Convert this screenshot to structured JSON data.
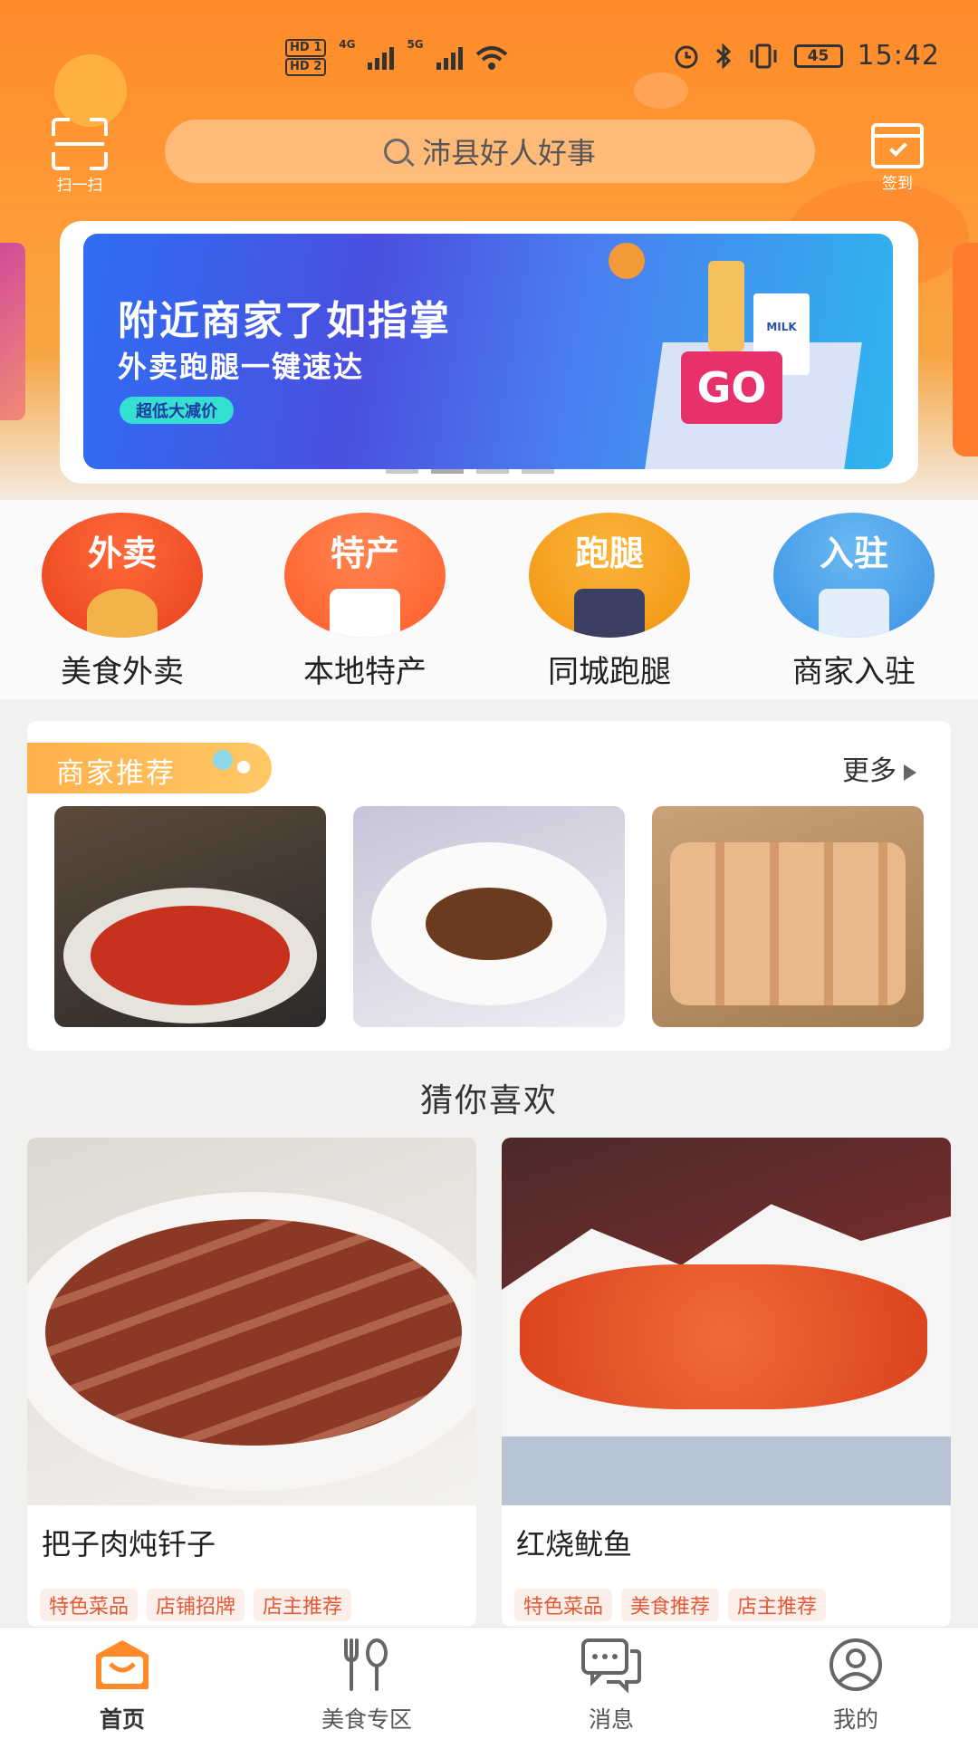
{
  "status_bar": {
    "hd1": "HD 1",
    "hd2": "HD 2",
    "net1": "4G",
    "net2": "5G",
    "battery": "45",
    "time": "15:42"
  },
  "header": {
    "scan_label": "扫一扫",
    "search_placeholder": "沛县好人好事",
    "checkin_label": "签到"
  },
  "banner": {
    "headline": "附近商家了如指掌",
    "subline": "外卖跑腿一键速达",
    "pill": "超低大减价",
    "go": "GO",
    "milk": "MILK"
  },
  "categories": [
    {
      "badge": "外卖",
      "name": "美食外卖",
      "color": "#f0512a"
    },
    {
      "badge": "特产",
      "name": "本地特产",
      "color": "#ff6c36"
    },
    {
      "badge": "跑腿",
      "name": "同城跑腿",
      "color": "#f5a11f"
    },
    {
      "badge": "入驻",
      "name": "商家入驻",
      "color": "#4aa2ea"
    }
  ],
  "recommend": {
    "title": "商家推荐",
    "more": "更多"
  },
  "guess": {
    "title": "猜你喜欢",
    "items": [
      {
        "title": "把子肉炖钎子",
        "tags": [
          "特色菜品",
          "店铺招牌",
          "店主推荐"
        ]
      },
      {
        "title": "红烧鱿鱼",
        "tags": [
          "特色菜品",
          "美食推荐",
          "店主推荐"
        ]
      }
    ]
  },
  "tabs": [
    {
      "label": "首页",
      "icon": "home-icon",
      "active": true
    },
    {
      "label": "美食专区",
      "icon": "food-icon",
      "active": false
    },
    {
      "label": "消息",
      "icon": "message-icon",
      "active": false
    },
    {
      "label": "我的",
      "icon": "profile-icon",
      "active": false
    }
  ],
  "colors": {
    "accent": "#ff8a2a",
    "tag_text": "#e05a3a"
  }
}
